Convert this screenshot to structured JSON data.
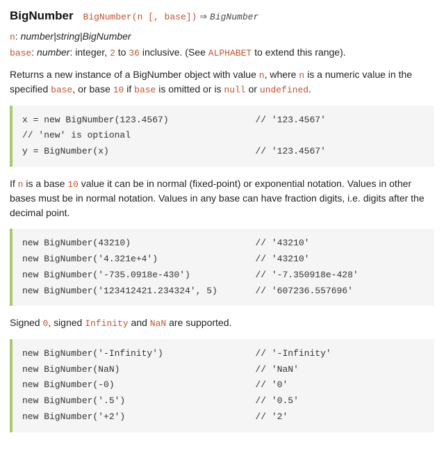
{
  "header": {
    "title": "BigNumber",
    "signature": "BigNumber(n [, base])",
    "arrow": "⇒",
    "ret": "BigNumber"
  },
  "params": {
    "n_name": "n",
    "n_type": "number|string|BigNumber",
    "base_name": "base",
    "base_type_prefix": "number",
    "base_text1": ": integer, ",
    "base_min": "2",
    "base_mid": " to ",
    "base_max": "36",
    "base_text2": " inclusive. (See ",
    "alphabet": "ALPHABET",
    "base_text3": " to extend this range)."
  },
  "desc1": {
    "t1": "Returns a new instance of a BigNumber object with value ",
    "n": "n",
    "t2": ", where ",
    "n2": "n",
    "t3": " is a numeric value in the specified ",
    "base": "base",
    "t4": ", or base ",
    "ten": "10",
    "t5": " if ",
    "base2": "base",
    "t6": " is omitted or is ",
    "null": "null",
    "t7": " or ",
    "undef": "undefined",
    "t8": "."
  },
  "code1": "x = new BigNumber(123.4567)                // '123.4567'\n// 'new' is optional\ny = BigNumber(x)                           // '123.4567'",
  "desc2": {
    "t1": "If ",
    "n": "n",
    "t2": " is a base ",
    "ten": "10",
    "t3": " value it can be in normal (fixed-point) or exponential notation. Values in other bases must be in normal notation. Values in any base can have fraction digits, i.e. digits after the decimal point."
  },
  "code2": "new BigNumber(43210)                       // '43210'\nnew BigNumber('4.321e+4')                  // '43210'\nnew BigNumber('-735.0918e-430')            // '-7.350918e-428'\nnew BigNumber('123412421.234324', 5)       // '607236.557696'",
  "desc3": {
    "t1": "Signed ",
    "zero": "0",
    "t2": ", signed ",
    "inf": "Infinity",
    "t3": " and ",
    "nan": "NaN",
    "t4": " are supported."
  },
  "code3": "new BigNumber('-Infinity')                 // '-Infinity'\nnew BigNumber(NaN)                         // 'NaN'\nnew BigNumber(-0)                          // '0'\nnew BigNumber('.5')                        // '0.5'\nnew BigNumber('+2')                        // '2'"
}
